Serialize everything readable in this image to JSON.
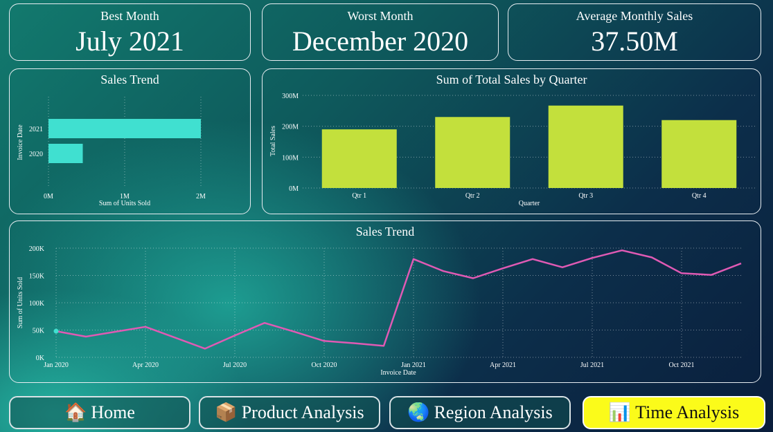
{
  "kpis": [
    {
      "label": "Best Month",
      "value": "July 2021"
    },
    {
      "label": "Worst Month",
      "value": "December 2020"
    },
    {
      "label": "Average Monthly Sales",
      "value": "37.50M"
    }
  ],
  "nav": [
    {
      "label": "Home",
      "icon": "house-icon"
    },
    {
      "label": "Product Analysis",
      "icon": "package-icon"
    },
    {
      "label": "Region Analysis",
      "icon": "globe-icon"
    },
    {
      "label": "Time Analysis",
      "icon": "chart-clock-icon",
      "active": true
    }
  ],
  "colors": {
    "bar_teal": "#40e0d0",
    "bar_lime": "#c3e03c",
    "line_pink": "#e05ab4",
    "active_nav": "#fbfb1a"
  },
  "chart_data": [
    {
      "type": "bar",
      "orientation": "horizontal",
      "title": "Sales Trend",
      "xlabel": "Sum of Units Sold",
      "ylabel": "Invoice Date",
      "categories": [
        "2021",
        "2020"
      ],
      "values": [
        2.0,
        0.45
      ],
      "x_ticks": [
        "0M",
        "1M",
        "2M"
      ],
      "xlim": [
        0,
        2
      ]
    },
    {
      "type": "bar",
      "title": "Sum of Total Sales by Quarter",
      "xlabel": "Quarter",
      "ylabel": "Total Sales",
      "categories": [
        "Qtr 1",
        "Qtr 2",
        "Qtr 3",
        "Qtr 4"
      ],
      "values": [
        190,
        230,
        267,
        220
      ],
      "y_ticks": [
        "0M",
        "100M",
        "200M",
        "300M"
      ],
      "ylim": [
        0,
        300
      ]
    },
    {
      "type": "line",
      "title": "Sales Trend",
      "xlabel": "Invoice Date",
      "ylabel": "Sum of Units Sold",
      "x": [
        "2020-01",
        "2020-02",
        "2020-03",
        "2020-04",
        "2020-05",
        "2020-06",
        "2020-07",
        "2020-08",
        "2020-09",
        "2020-10",
        "2020-11",
        "2020-12",
        "2021-01",
        "2021-02",
        "2021-03",
        "2021-04",
        "2021-05",
        "2021-06",
        "2021-07",
        "2021-08",
        "2021-09",
        "2021-10",
        "2021-11",
        "2021-12"
      ],
      "values": [
        48,
        38,
        47,
        56,
        36,
        16,
        40,
        63,
        47,
        30,
        26,
        21,
        180,
        158,
        145,
        163,
        180,
        165,
        182,
        196,
        183,
        154,
        151,
        172
      ],
      "x_ticks": [
        "Jan 2020",
        "Apr 2020",
        "Jul 2020",
        "Oct 2020",
        "Jan 2021",
        "Apr 2021",
        "Jul 2021",
        "Oct 2021"
      ],
      "y_ticks": [
        "0K",
        "50K",
        "100K",
        "150K",
        "200K"
      ],
      "ylim": [
        0,
        200
      ]
    }
  ]
}
